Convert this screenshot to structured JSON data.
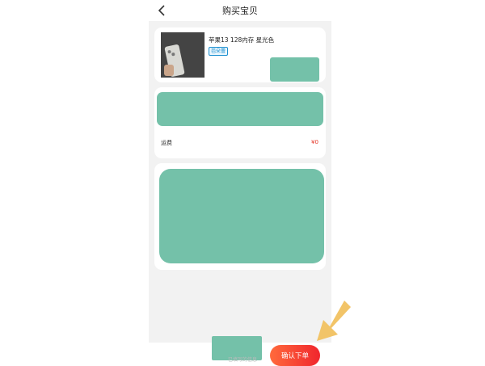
{
  "header": {
    "title": "购买宝贝"
  },
  "product": {
    "title": "苹果13  128内存  星光色",
    "tag": "芭朵蕾"
  },
  "shipping": {
    "label": "运费",
    "value": "¥0"
  },
  "footer": {
    "confirm_label": "确认下单",
    "note": "已填写的信息"
  },
  "colors": {
    "redaction": "#74c1a9",
    "accent": "#f0262d",
    "annotation_arrow": "#f2c468",
    "page_bg": "#f2f2f2"
  }
}
